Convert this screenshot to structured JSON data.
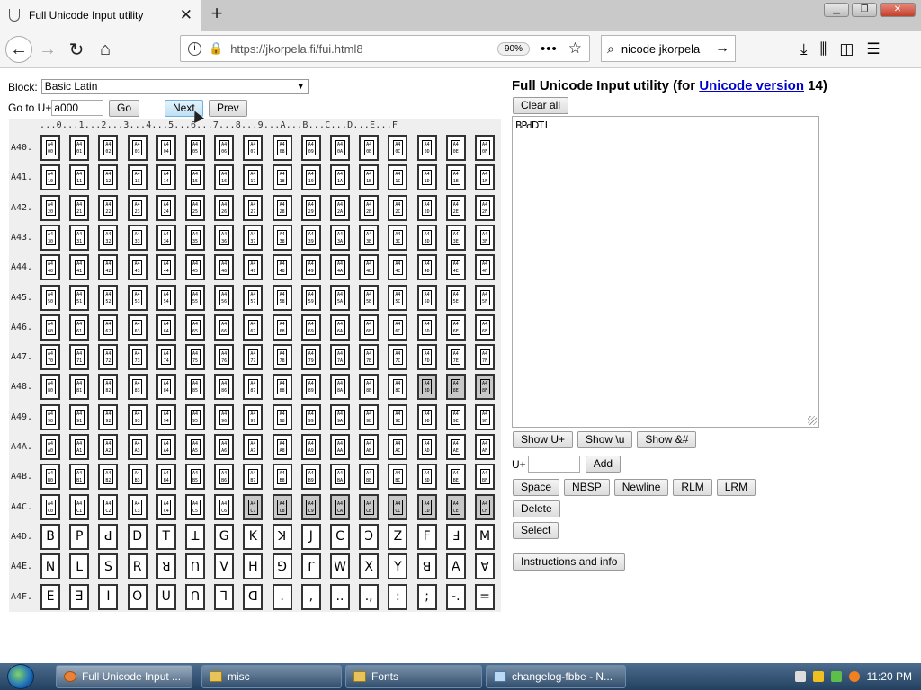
{
  "browser": {
    "tab_title": "Full Unicode Input utility",
    "url": "https://jkorpela.fi/fui.html8",
    "zoom": "90%",
    "search_value": "nicode jkorpela"
  },
  "form": {
    "block_label": "Block:",
    "block_value": "Basic Latin",
    "goto_label": "Go to U+",
    "goto_value": "a000",
    "go_button": "Go",
    "next_button": "Next",
    "prev_button": "Prev"
  },
  "grid": {
    "column_header": "...0...1...2...3...4...5...6...7...8...9...A...B...C...D...E...F",
    "rows": [
      {
        "label": "A40.",
        "cells": [
          "A400",
          "A401",
          "A402",
          "A403",
          "A404",
          "A405",
          "A406",
          "A407",
          "A408",
          "A409",
          "A40A",
          "A40B",
          "A40C",
          "A40D",
          "A40E",
          "A40F"
        ],
        "gray": []
      },
      {
        "label": "A41.",
        "cells": [
          "A410",
          "A411",
          "A412",
          "A413",
          "A414",
          "A415",
          "A416",
          "A417",
          "A418",
          "A419",
          "A41A",
          "A41B",
          "A41C",
          "A41D",
          "A41E",
          "A41F"
        ],
        "gray": []
      },
      {
        "label": "A42.",
        "cells": [
          "A420",
          "A421",
          "A422",
          "A423",
          "A424",
          "A425",
          "A426",
          "A427",
          "A428",
          "A429",
          "A42A",
          "A42B",
          "A42C",
          "A42D",
          "A42E",
          "A42F"
        ],
        "gray": []
      },
      {
        "label": "A43.",
        "cells": [
          "A430",
          "A431",
          "A432",
          "A433",
          "A434",
          "A435",
          "A436",
          "A437",
          "A438",
          "A439",
          "A43A",
          "A43B",
          "A43C",
          "A43D",
          "A43E",
          "A43F"
        ],
        "gray": []
      },
      {
        "label": "A44.",
        "cells": [
          "A440",
          "A441",
          "A442",
          "A443",
          "A444",
          "A445",
          "A446",
          "A447",
          "A448",
          "A449",
          "A44A",
          "A44B",
          "A44C",
          "A44D",
          "A44E",
          "A44F"
        ],
        "gray": []
      },
      {
        "label": "A45.",
        "cells": [
          "A450",
          "A451",
          "A452",
          "A453",
          "A454",
          "A455",
          "A456",
          "A457",
          "A458",
          "A459",
          "A45A",
          "A45B",
          "A45C",
          "A45D",
          "A45E",
          "A45F"
        ],
        "gray": []
      },
      {
        "label": "A46.",
        "cells": [
          "A460",
          "A461",
          "A462",
          "A463",
          "A464",
          "A465",
          "A466",
          "A467",
          "A468",
          "A469",
          "A46A",
          "A46B",
          "A46C",
          "A46D",
          "A46E",
          "A46F"
        ],
        "gray": []
      },
      {
        "label": "A47.",
        "cells": [
          "A470",
          "A471",
          "A472",
          "A473",
          "A474",
          "A475",
          "A476",
          "A477",
          "A478",
          "A479",
          "A47A",
          "A47B",
          "A47C",
          "A47D",
          "A47E",
          "A47F"
        ],
        "gray": []
      },
      {
        "label": "A48.",
        "cells": [
          "A480",
          "A481",
          "A482",
          "A483",
          "A484",
          "A485",
          "A486",
          "A487",
          "A488",
          "A489",
          "A48A",
          "A48B",
          "A48C",
          "A48D",
          "A48E",
          "A48F"
        ],
        "gray": [
          13,
          14,
          15
        ]
      },
      {
        "label": "A49.",
        "cells": [
          "A490",
          "A491",
          "A492",
          "A493",
          "A494",
          "A495",
          "A496",
          "A497",
          "A498",
          "A499",
          "A49A",
          "A49B",
          "A49C",
          "A49D",
          "A49E",
          "A49F"
        ],
        "gray": []
      },
      {
        "label": "A4A.",
        "cells": [
          "A4A0",
          "A4A1",
          "A4A2",
          "A4A3",
          "A4A4",
          "A4A5",
          "A4A6",
          "A4A7",
          "A4A8",
          "A4A9",
          "A4AA",
          "A4AB",
          "A4AC",
          "A4AD",
          "A4AE",
          "A4AF"
        ],
        "gray": []
      },
      {
        "label": "A4B.",
        "cells": [
          "A4B0",
          "A4B1",
          "A4B2",
          "A4B3",
          "A4B4",
          "A4B5",
          "A4B6",
          "A4B7",
          "A4B8",
          "A4B9",
          "A4BA",
          "A4BB",
          "A4BC",
          "A4BD",
          "A4BE",
          "A4BF"
        ],
        "gray": []
      },
      {
        "label": "A4C.",
        "cells": [
          "A4C0",
          "A4C1",
          "A4C2",
          "A4C3",
          "A4C4",
          "A4C5",
          "A4C6",
          "A4C7",
          "A4C8",
          "A4C9",
          "A4CA",
          "A4CB",
          "A4CC",
          "A4CD",
          "A4CE",
          "A4CF"
        ],
        "gray": [
          7,
          8,
          9,
          10,
          11,
          12,
          13,
          14,
          15
        ]
      },
      {
        "label": "A4D.",
        "chars": [
          "B",
          "P",
          "ꓒ",
          "D",
          "T",
          "ꓕ",
          "G",
          "K",
          "ꓘ",
          "J",
          "C",
          "Ↄ",
          "Z",
          "F",
          "Ⅎ",
          "M"
        ],
        "gray": []
      },
      {
        "label": "A4E.",
        "chars": [
          "N",
          "L",
          "S",
          "R",
          "ꓤ",
          "ꓵ",
          "V",
          "H",
          "⅁",
          "ꓩ",
          "W",
          "X",
          "Y",
          "ꓭ",
          "A",
          "ꓯ"
        ],
        "gray": []
      },
      {
        "label": "A4F.",
        "chars": [
          "E",
          "Ǝ",
          "I",
          "O",
          "U",
          "ꓵ",
          "⅂",
          "ꓷ",
          ".",
          ",",
          "..",
          ".,",
          ":",
          ";",
          "-.",
          "="
        ],
        "gray": []
      }
    ]
  },
  "right": {
    "title_prefix": "Full Unicode Input utility (for ",
    "title_link": "Unicode version",
    "title_suffix": " 14)",
    "clear_all": "Clear all",
    "textarea_value": "ꓐꓑꓒꓓꓔꓕ",
    "show_uplus": "Show U+",
    "show_u": "Show \\u",
    "show_amp": "Show &#",
    "uplus_label": "U+",
    "add_button": "Add",
    "space": "Space",
    "nbsp": "NBSP",
    "newline": "Newline",
    "rlm": "RLM",
    "lrm": "LRM",
    "delete": "Delete",
    "select": "Select",
    "instructions": "Instructions and info"
  },
  "taskbar": {
    "items": [
      "Full Unicode Input ...",
      "misc",
      "Fonts",
      "changelog-fbbe - N..."
    ],
    "clock": "11:20 PM"
  }
}
